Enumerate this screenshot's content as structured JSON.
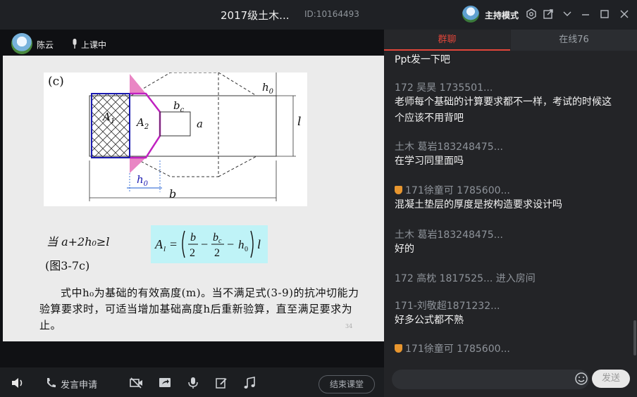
{
  "window": {
    "title": "2017级土木...",
    "room_id": "ID:10164493",
    "host_mode": "主持模式"
  },
  "presenter": {
    "name": "陈云",
    "status": "上课中"
  },
  "slide": {
    "figure_label": "(c)",
    "labels": {
      "A1": "A",
      "A1_sub": "1",
      "A2": "A",
      "A2_sub": "2",
      "bc": "b",
      "bc_sub": "c",
      "a": "a",
      "h0_top": "h",
      "h0_top_sub": "0",
      "l": "l",
      "h0_bottom": "h",
      "h0_bottom_sub": "0",
      "b": "b"
    },
    "condition": "当 a+2h₀≥l",
    "ref": "(图3-7c)",
    "formula": "A_l = (b/2 − b_c/2 − h₀) l",
    "paragraph": "式中h₀为基础的有效高度(m)。当不满足式(3-9)的抗冲切能力验算要求时，可适当增加基础高度h后重新验算，直至满足要求为止。",
    "page_number": "34"
  },
  "bottom_bar": {
    "apply_speak": "发言申请",
    "end_class": "结束课堂"
  },
  "chat": {
    "tabs": [
      {
        "label": "群聊",
        "active": true
      },
      {
        "label": "在线76",
        "active": false
      }
    ],
    "messages": [
      {
        "sender": "",
        "text": "Ppt发一下吧",
        "medal": false
      },
      {
        "sender": "172 吴昊 1735501...",
        "text": "老师每个基础的计算要求都不一样，考试的时候这个应该不用背吧",
        "medal": false
      },
      {
        "sender": "土木 葛岩183248475...",
        "text": "在学习同里面吗",
        "medal": false
      },
      {
        "sender": "171徐童可 1785600...",
        "text": "混凝土垫层的厚度是按构造要求设计吗",
        "medal": true
      },
      {
        "sender": "土木 葛岩183248475...",
        "text": "好的",
        "medal": false
      },
      {
        "sender": "172 高枕 1817525... 进入房间",
        "text": "",
        "medal": false
      },
      {
        "sender": "171-刘敬超1871232...",
        "text": "好多公式都不熟",
        "medal": false
      },
      {
        "sender": "171徐童可 1785600...",
        "text": "",
        "medal": true
      }
    ],
    "send_label": "发送",
    "input_placeholder": ""
  },
  "colors": {
    "accent": "#e2463a",
    "background": "#232427",
    "slide_highlight": "#bff3f7",
    "pink": "#e986c4",
    "magenta": "#c020c0",
    "navy": "#1a1ab0"
  }
}
